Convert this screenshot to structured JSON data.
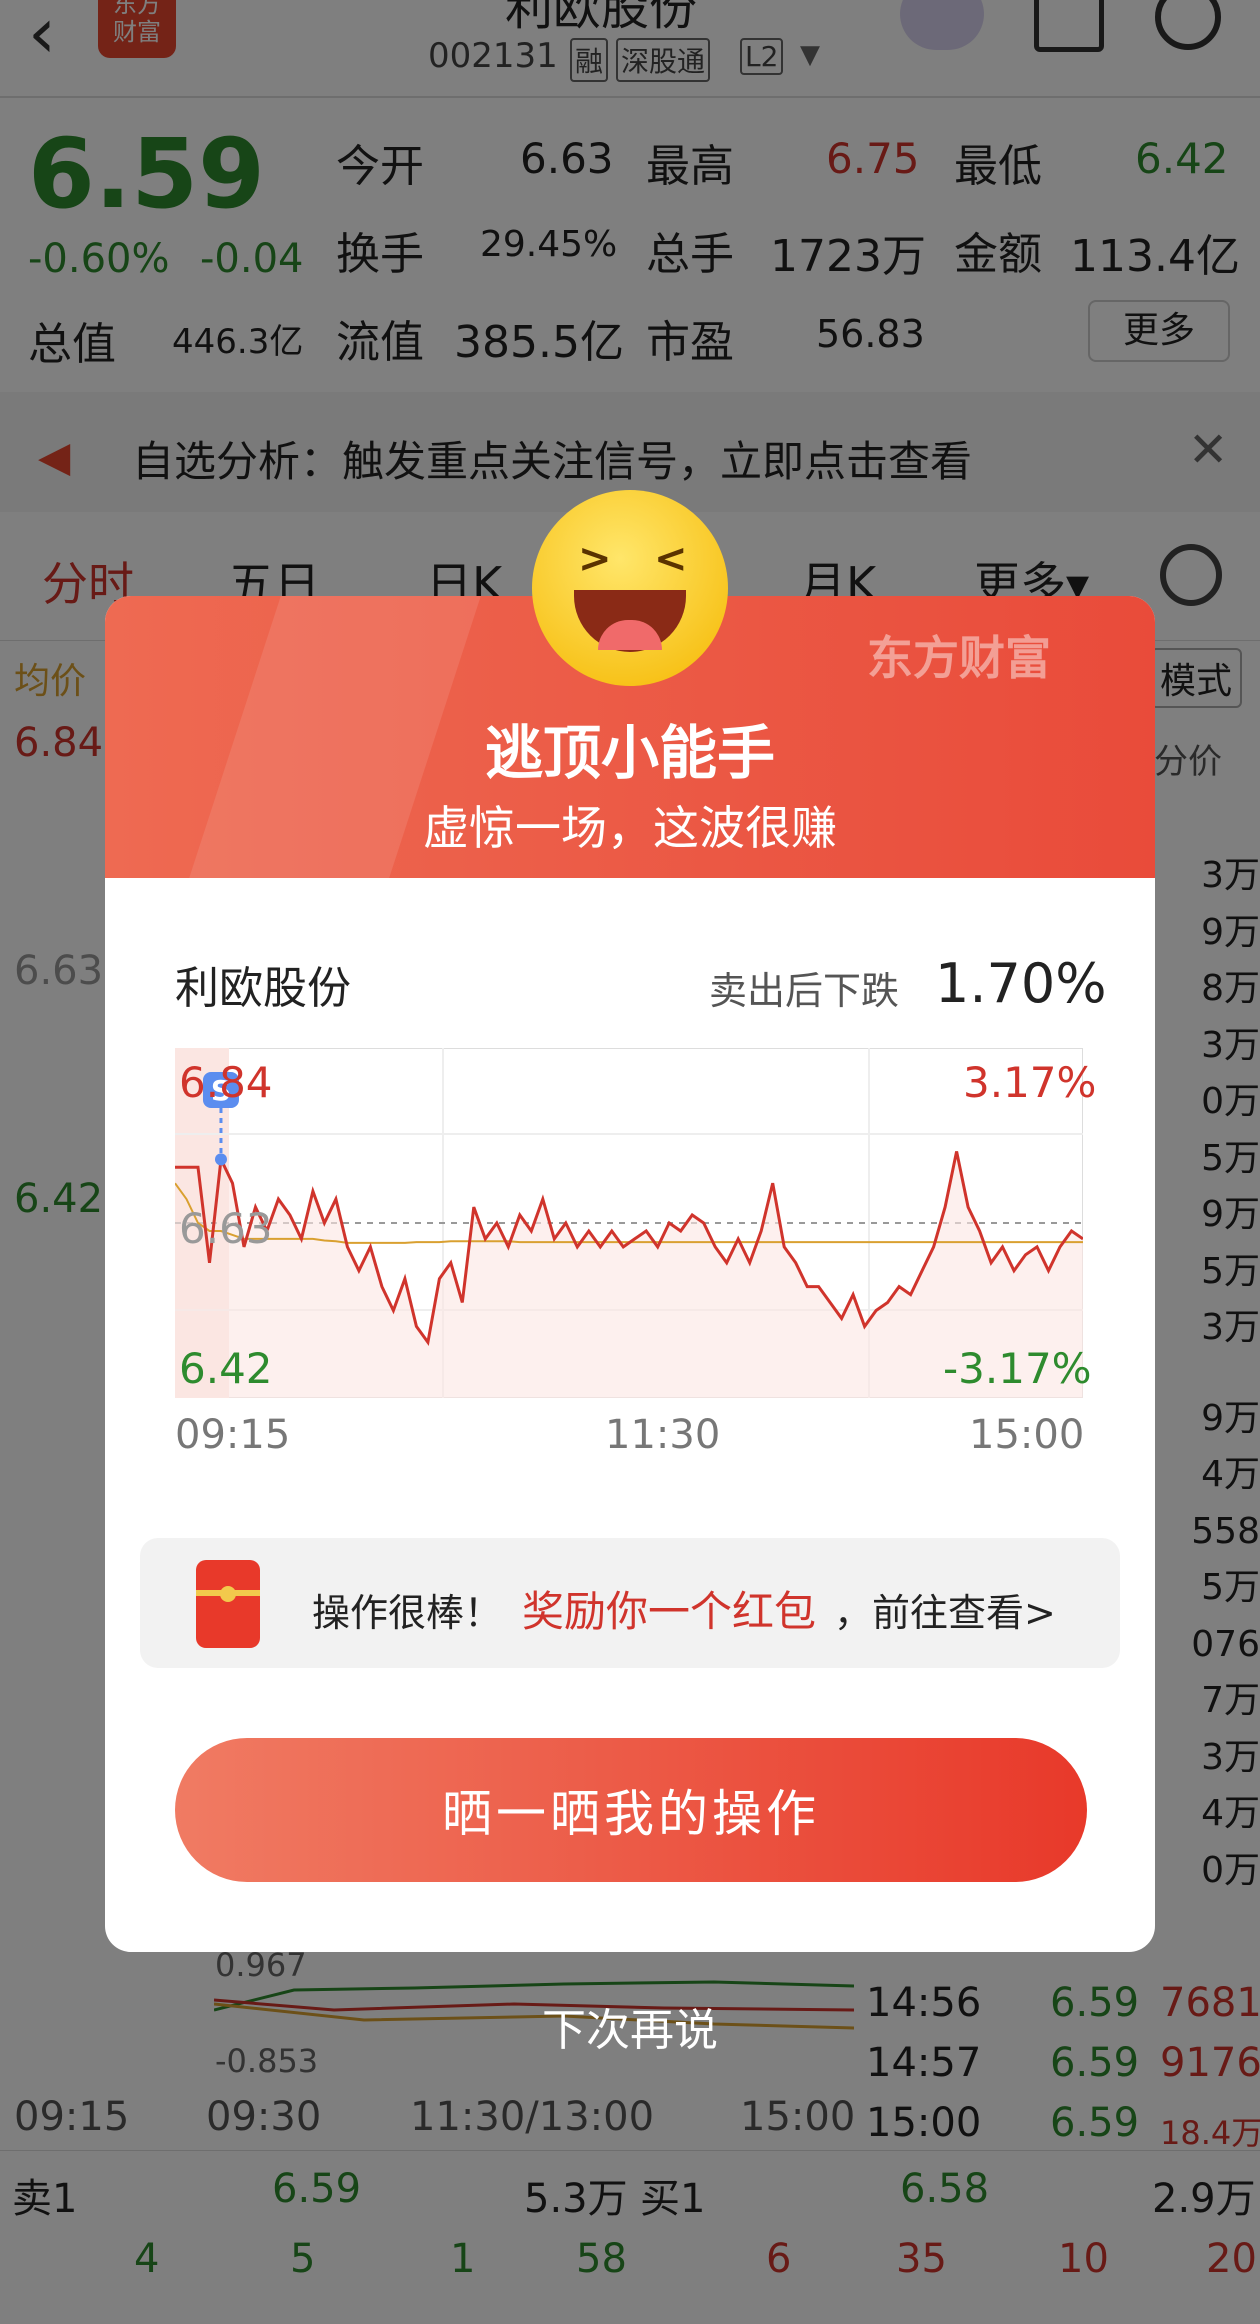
{
  "header": {
    "logo_text": "东方\n财富",
    "stock_name": "利欧股份",
    "code": "002131",
    "tags": [
      "融",
      "深股通",
      "L2"
    ]
  },
  "quote": {
    "price": "6.59",
    "change_pct": "-0.60%",
    "change_abs": "-0.04",
    "total_value_label": "总值",
    "total_value": "446.3亿",
    "stats": [
      {
        "label": "今开",
        "value": "6.63"
      },
      {
        "label": "最高",
        "value": "6.75"
      },
      {
        "label": "最低",
        "value": "6.42"
      },
      {
        "label": "换手",
        "value": "29.45%"
      },
      {
        "label": "总手",
        "value": "1723万"
      },
      {
        "label": "金额",
        "value": "113.4亿"
      },
      {
        "label": "流值",
        "value": "385.5亿"
      },
      {
        "label": "市盈",
        "value": "56.83"
      }
    ],
    "more_label": "更多"
  },
  "notice": {
    "text": "自选分析：触发重点关注信号，立即点击查看"
  },
  "tabs": [
    "分时",
    "五日",
    "日K",
    "月K",
    "更多▾"
  ],
  "chart_bg": {
    "avg_label": "均价",
    "y_high": "6.84",
    "y_mid": "6.63",
    "y_low": "6.42",
    "mode_label": "模式",
    "order_header": "分价",
    "order_rows": [
      "3万",
      "9万",
      "8万",
      "3万",
      "0万",
      "5万",
      "9万",
      "5万",
      "3万",
      "9万",
      "4万",
      "558",
      "5万",
      "076",
      "7万",
      "3万",
      "4万",
      "0万"
    ],
    "ind_high": "0.967",
    "ind_low": "-0.853",
    "time_axis": [
      "09:15",
      "09:30",
      "11:30/13:00",
      "15:00"
    ]
  },
  "ticks": [
    {
      "time": "14:56",
      "price": "6.59",
      "vol": "7681"
    },
    {
      "time": "14:57",
      "price": "6.59",
      "vol": "9176"
    },
    {
      "time": "15:00",
      "price": "6.59",
      "vol": "18.4万"
    }
  ],
  "book": {
    "sell_label": "卖1",
    "sell_price": "6.59",
    "sell_vol": "5.3万",
    "buy_label": "买1",
    "buy_price": "6.58",
    "buy_vol": "2.9万",
    "counts": [
      "4",
      "5",
      "1",
      "58",
      "6",
      "35",
      "10",
      "20"
    ]
  },
  "modal": {
    "brand": "东方财富",
    "title": "逃顶小能手",
    "subtitle": "虚惊一场，这波很赚",
    "stock_name": "利欧股份",
    "drop_label": "卖出后下跌",
    "drop_value": "1.70%",
    "reward": {
      "prefix": "操作很棒！",
      "highlight": "奖励你一个红包",
      "suffix": "，前往查看>"
    },
    "cta": "晒一晒我的操作",
    "later": "下次再说"
  },
  "chart_data": {
    "type": "line",
    "price_max_label": "6.84",
    "price_mid_label": "6.63",
    "price_min_label": "6.42",
    "pct_max_label": "3.17%",
    "pct_min_label": "-3.17%",
    "x_ticks": [
      "09:15",
      "11:30",
      "15:00"
    ],
    "ylim": [
      6.42,
      6.84
    ],
    "colors": {
      "price": "#d0342c",
      "avg": "#d9a030",
      "fill": "#fbe6e2",
      "marker": "#5b8def"
    },
    "sell_marker": {
      "label": "S",
      "index": 4
    },
    "price": [
      6.7,
      6.7,
      6.7,
      6.58,
      6.71,
      6.68,
      6.6,
      6.65,
      6.62,
      6.66,
      6.64,
      6.61,
      6.67,
      6.63,
      6.66,
      6.6,
      6.57,
      6.6,
      6.55,
      6.52,
      6.56,
      6.5,
      6.48,
      6.56,
      6.58,
      6.53,
      6.65,
      6.61,
      6.63,
      6.6,
      6.64,
      6.62,
      6.66,
      6.61,
      6.63,
      6.6,
      6.62,
      6.6,
      6.62,
      6.6,
      6.61,
      6.62,
      6.6,
      6.63,
      6.62,
      6.64,
      6.63,
      6.6,
      6.58,
      6.61,
      6.58,
      6.62,
      6.68,
      6.6,
      6.58,
      6.55,
      6.55,
      6.53,
      6.51,
      6.54,
      6.5,
      6.52,
      6.53,
      6.55,
      6.54,
      6.57,
      6.6,
      6.65,
      6.72,
      6.65,
      6.62,
      6.58,
      6.6,
      6.57,
      6.59,
      6.6,
      6.57,
      6.6,
      6.62,
      6.61
    ],
    "avg": [
      6.68,
      6.66,
      6.63,
      6.62,
      6.62,
      6.615,
      6.61,
      6.61,
      6.61,
      6.61,
      6.61,
      6.61,
      6.61,
      6.608,
      6.607,
      6.605,
      6.605,
      6.605,
      6.605,
      6.605,
      6.605,
      6.606,
      6.606,
      6.606,
      6.607,
      6.607,
      6.607,
      6.607,
      6.607,
      6.607,
      6.606,
      6.606,
      6.606,
      6.606,
      6.606,
      6.606,
      6.606,
      6.606,
      6.606,
      6.606,
      6.606,
      6.606,
      6.606,
      6.606,
      6.606,
      6.606,
      6.606,
      6.606,
      6.606,
      6.606,
      6.606,
      6.606,
      6.606,
      6.606,
      6.606,
      6.606,
      6.606,
      6.606,
      6.606,
      6.606,
      6.606,
      6.606,
      6.606,
      6.606,
      6.606,
      6.606,
      6.606,
      6.606,
      6.606,
      6.606,
      6.606,
      6.606,
      6.606,
      6.606,
      6.606,
      6.606,
      6.606,
      6.606,
      6.606,
      6.606
    ]
  }
}
